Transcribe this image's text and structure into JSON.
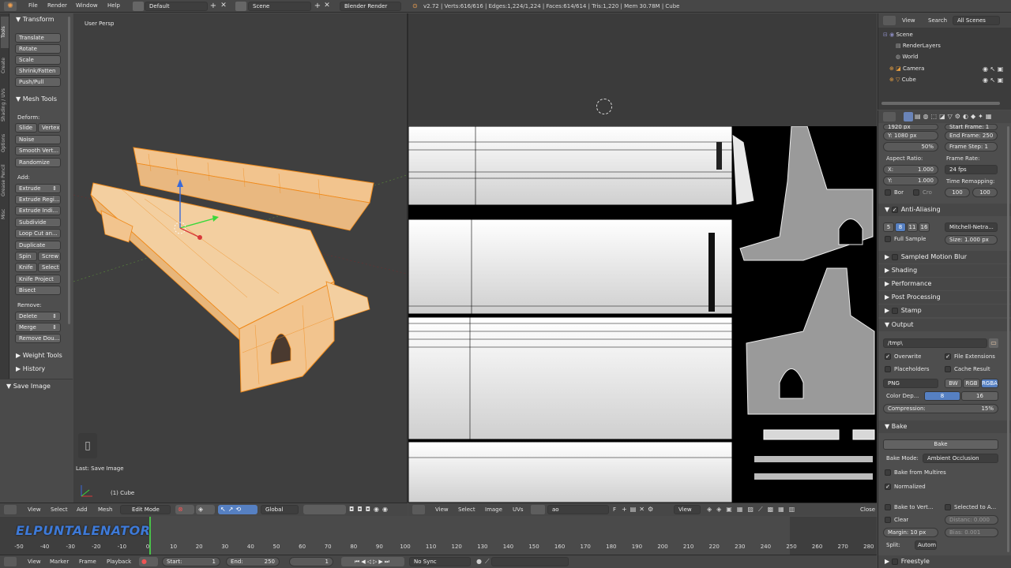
{
  "topbar": {
    "menus": [
      "File",
      "Render",
      "Window",
      "Help"
    ],
    "layout": "Default",
    "scene": "Scene",
    "engine": "Blender Render",
    "stats": "v2.72 | Verts:616/616 | Edges:1,224/1,224 | Faces:614/614 | Tris:1,220 | Mem 30.78M | Cube"
  },
  "toolshelf": {
    "tabs": [
      "Tools",
      "Create",
      "Shading / UVs",
      "Options",
      "Grease Pencil",
      "Misc"
    ],
    "transform_header": "Transform",
    "transform": [
      "Translate",
      "Rotate",
      "Scale",
      "Shrink/Fatten",
      "Push/Pull"
    ],
    "meshtools_header": "Mesh Tools",
    "deform_label": "Deform:",
    "slide": "Slide",
    "vertex": "Vertex",
    "noise": "Noise",
    "smooth": "Smooth Vert...",
    "randomize": "Randomize",
    "add_label": "Add:",
    "extrude": "Extrude",
    "add": [
      "Extrude Regi...",
      "Extrude Indi...",
      "Subdivide",
      "Loop Cut an...",
      "Duplicate"
    ],
    "spin": "Spin",
    "screw": "Screw",
    "knife": "Knife",
    "select": "Select",
    "knife_project": "Knife Project",
    "bisect": "Bisect",
    "remove_label": "Remove:",
    "delete": "Delete",
    "merge": "Merge",
    "remove_doubles": "Remove Dou...",
    "weight_tools": "Weight Tools",
    "history": "History",
    "save_image": "Save Image"
  },
  "viewport": {
    "persp": "User Persp",
    "last_op": "Last: Save Image",
    "object": "(1) Cube"
  },
  "viewport_header": {
    "view": "View",
    "select": "Select",
    "add": "Add",
    "mesh": "Mesh",
    "mode": "Edit Mode",
    "orientation": "Global"
  },
  "image_header": {
    "view": "View",
    "select": "Select",
    "image": "Image",
    "uvs": "UVs",
    "image_name": "ao",
    "f": "F",
    "view2": "View",
    "close": "Close"
  },
  "outliner": {
    "view": "View",
    "search": "Search",
    "all_scenes": "All Scenes",
    "items": [
      "Scene",
      "RenderLayers",
      "World",
      "Camera",
      "Cube"
    ]
  },
  "properties": {
    "res_x": "1920 px",
    "start_frame": "Start Frame: 1",
    "res_y_label": "Y:",
    "res_y": "1080 px",
    "end_frame": "End Frame: 250",
    "res_pct": "50%",
    "frame_step": "Frame Step: 1",
    "aspect_ratio": "Aspect Ratio:",
    "frame_rate": "Frame Rate:",
    "asp_x_label": "X:",
    "asp_x": "1.000",
    "fps": "24 fps",
    "asp_y_label": "Y:",
    "asp_y": "1.000",
    "time_remapping": "Time Remapping:",
    "bor": "Bor",
    "cro": "Cro",
    "remap_old": "100",
    "remap_new": "100",
    "anti_aliasing": "Anti-Aliasing",
    "aa_samples": [
      "5",
      "8",
      "11",
      "16"
    ],
    "aa_filter": "Mitchell-Netra...",
    "full_sample": "Full Sample",
    "aa_size": "Size: 1.000 px",
    "panels": [
      "Sampled Motion Blur",
      "Shading",
      "Performance",
      "Post Processing",
      "Stamp"
    ],
    "output": "Output",
    "out_path": "/tmp\\",
    "overwrite": "Overwrite",
    "file_ext": "File Extensions",
    "placeholders": "Placeholders",
    "cache_result": "Cache Result",
    "format": "PNG",
    "bw": "BW",
    "rgb": "RGB",
    "rgba": "RGBA",
    "color_depth": "Color Dep...",
    "depth_8": "8",
    "depth_16": "16",
    "compression": "Compression:",
    "compression_val": "15%",
    "bake": "Bake",
    "bake_btn": "Bake",
    "bake_mode_label": "Bake Mode:",
    "bake_mode": "Ambient Occlusion",
    "bake_multires": "Bake from Multires",
    "normalized": "Normalized",
    "bake_to_vert": "Bake to Vert...",
    "selected_to_active": "Selected to A...",
    "clear": "Clear",
    "distance": "Distanc: 0.000",
    "margin": "Margin: 10 px",
    "bias": "Bias:   0.001",
    "split_label": "Split:",
    "split": "Autom",
    "freestyle": "Freestyle"
  },
  "timeline": {
    "ticks": [
      "-50",
      "-40",
      "-30",
      "-20",
      "-10",
      "0",
      "10",
      "20",
      "30",
      "40",
      "50",
      "60",
      "70",
      "80",
      "90",
      "100",
      "110",
      "120",
      "130",
      "140",
      "150",
      "160",
      "170",
      "180",
      "190",
      "200",
      "210",
      "220",
      "230",
      "240",
      "250",
      "260",
      "270",
      "280"
    ],
    "watermark": "ELPUNTALENATOR"
  },
  "bottombar": {
    "view": "View",
    "marker": "Marker",
    "frame": "Frame",
    "playback": "Playback",
    "start": "Start:",
    "start_val": "1",
    "end": "End:",
    "end_val": "250",
    "current": "1",
    "sync": "No Sync"
  }
}
